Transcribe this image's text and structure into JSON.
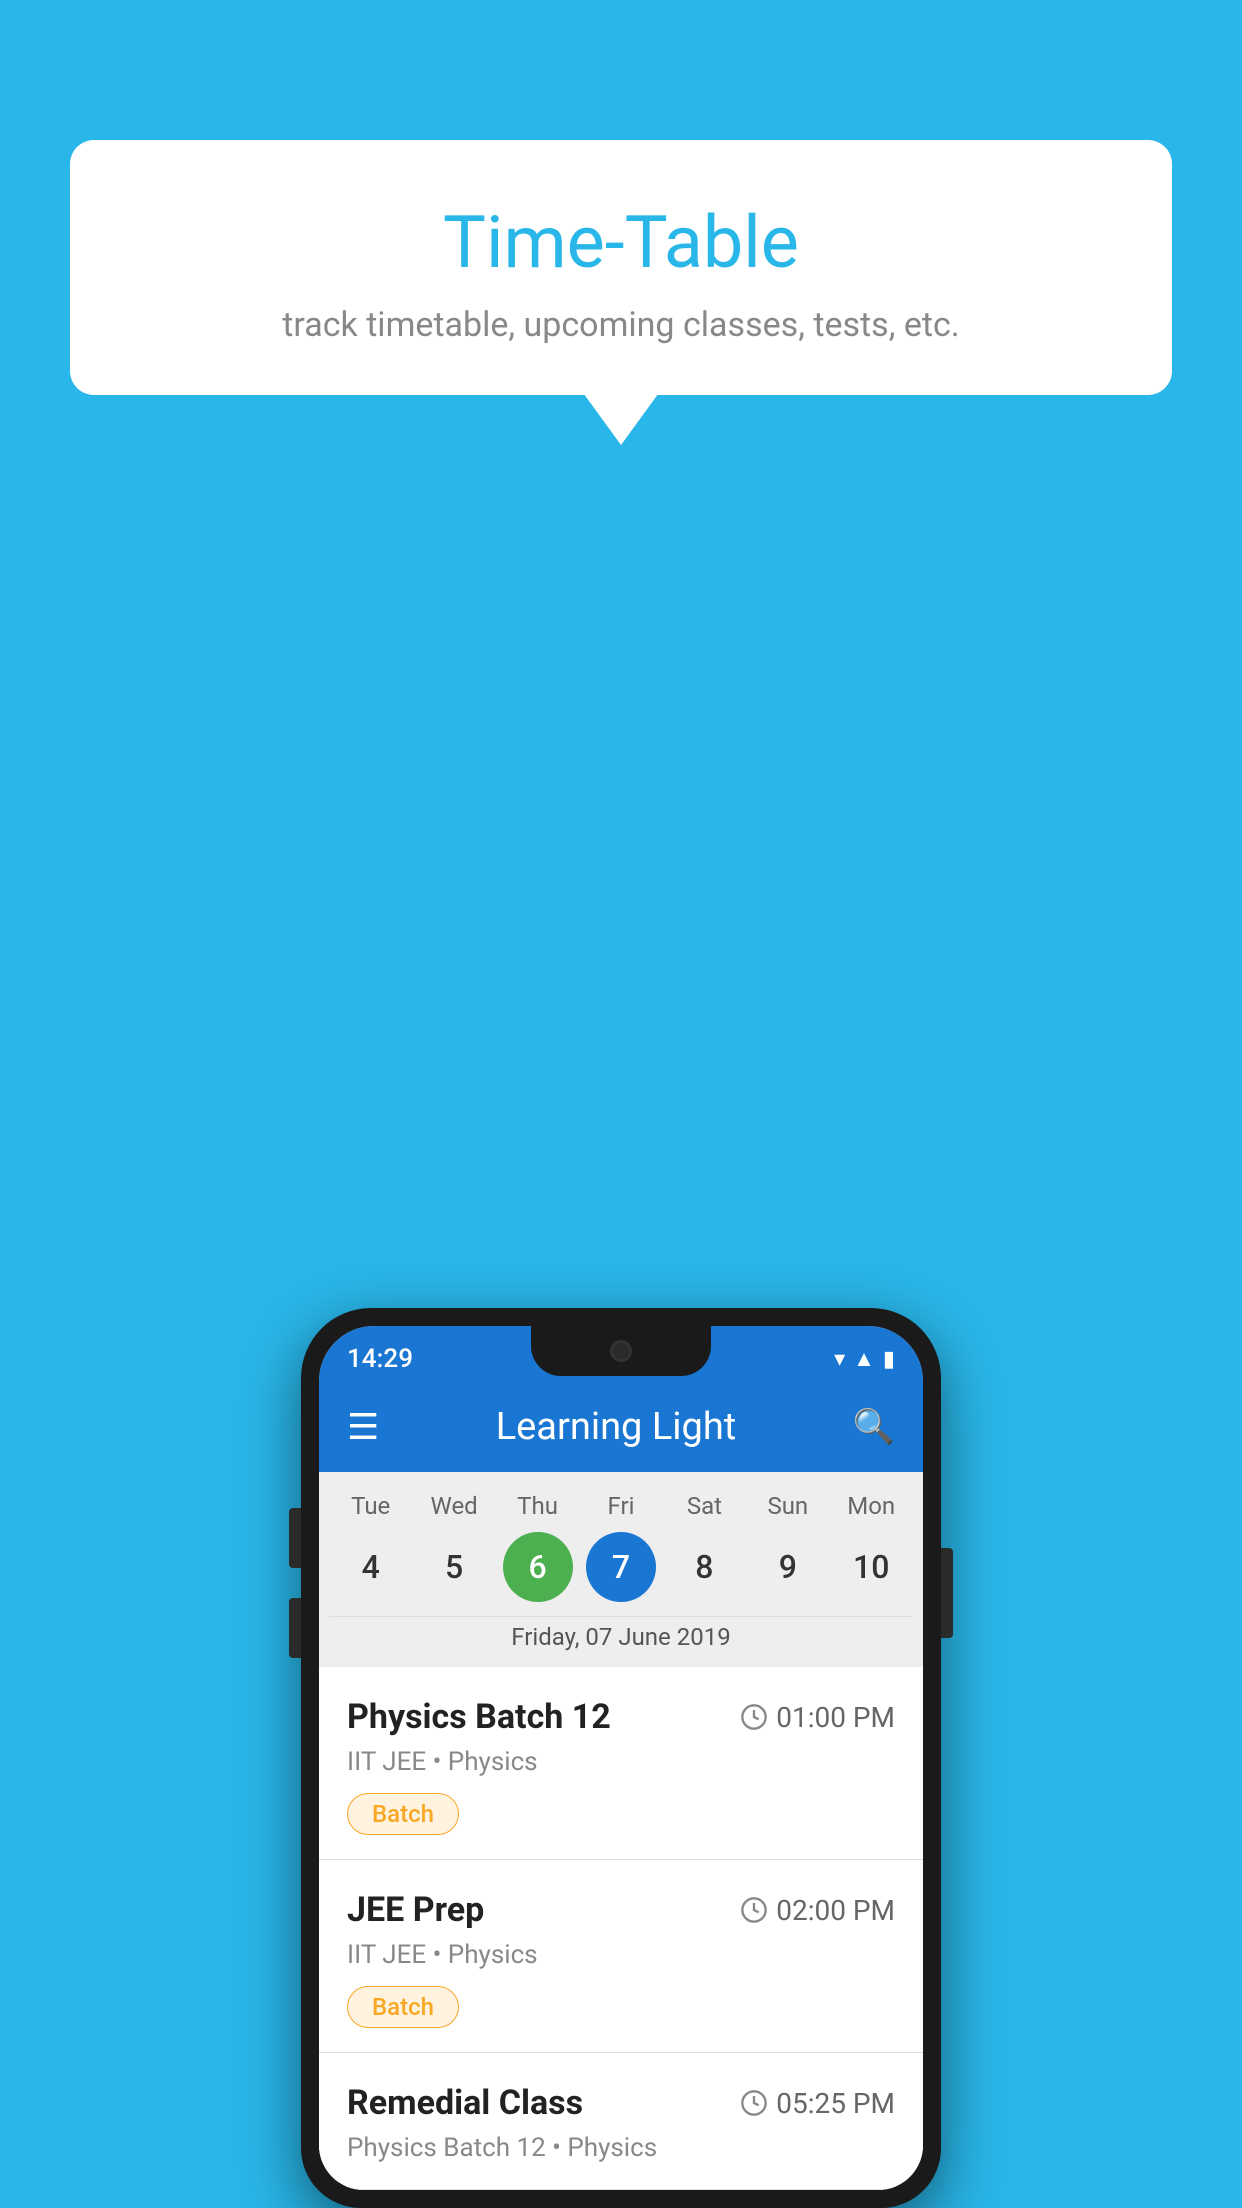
{
  "background_color": "#29b6e8",
  "bubble": {
    "title": "Time-Table",
    "subtitle": "track timetable, upcoming classes, tests, etc."
  },
  "phone": {
    "status_bar": {
      "time": "14:29"
    },
    "app_bar": {
      "title": "Learning Light"
    },
    "calendar": {
      "days": [
        "Tue",
        "Wed",
        "Thu",
        "Fri",
        "Sat",
        "Sun",
        "Mon"
      ],
      "dates": [
        "4",
        "5",
        "6",
        "7",
        "8",
        "9",
        "10"
      ],
      "today_index": 2,
      "selected_index": 3,
      "selected_label": "Friday, 07 June 2019"
    },
    "schedule_items": [
      {
        "title": "Physics Batch 12",
        "time": "01:00 PM",
        "subtitle": "IIT JEE • Physics",
        "tag": "Batch"
      },
      {
        "title": "JEE Prep",
        "time": "02:00 PM",
        "subtitle": "IIT JEE • Physics",
        "tag": "Batch"
      },
      {
        "title": "Remedial Class",
        "time": "05:25 PM",
        "subtitle": "Physics Batch 12 • Physics",
        "tag": null
      }
    ]
  }
}
